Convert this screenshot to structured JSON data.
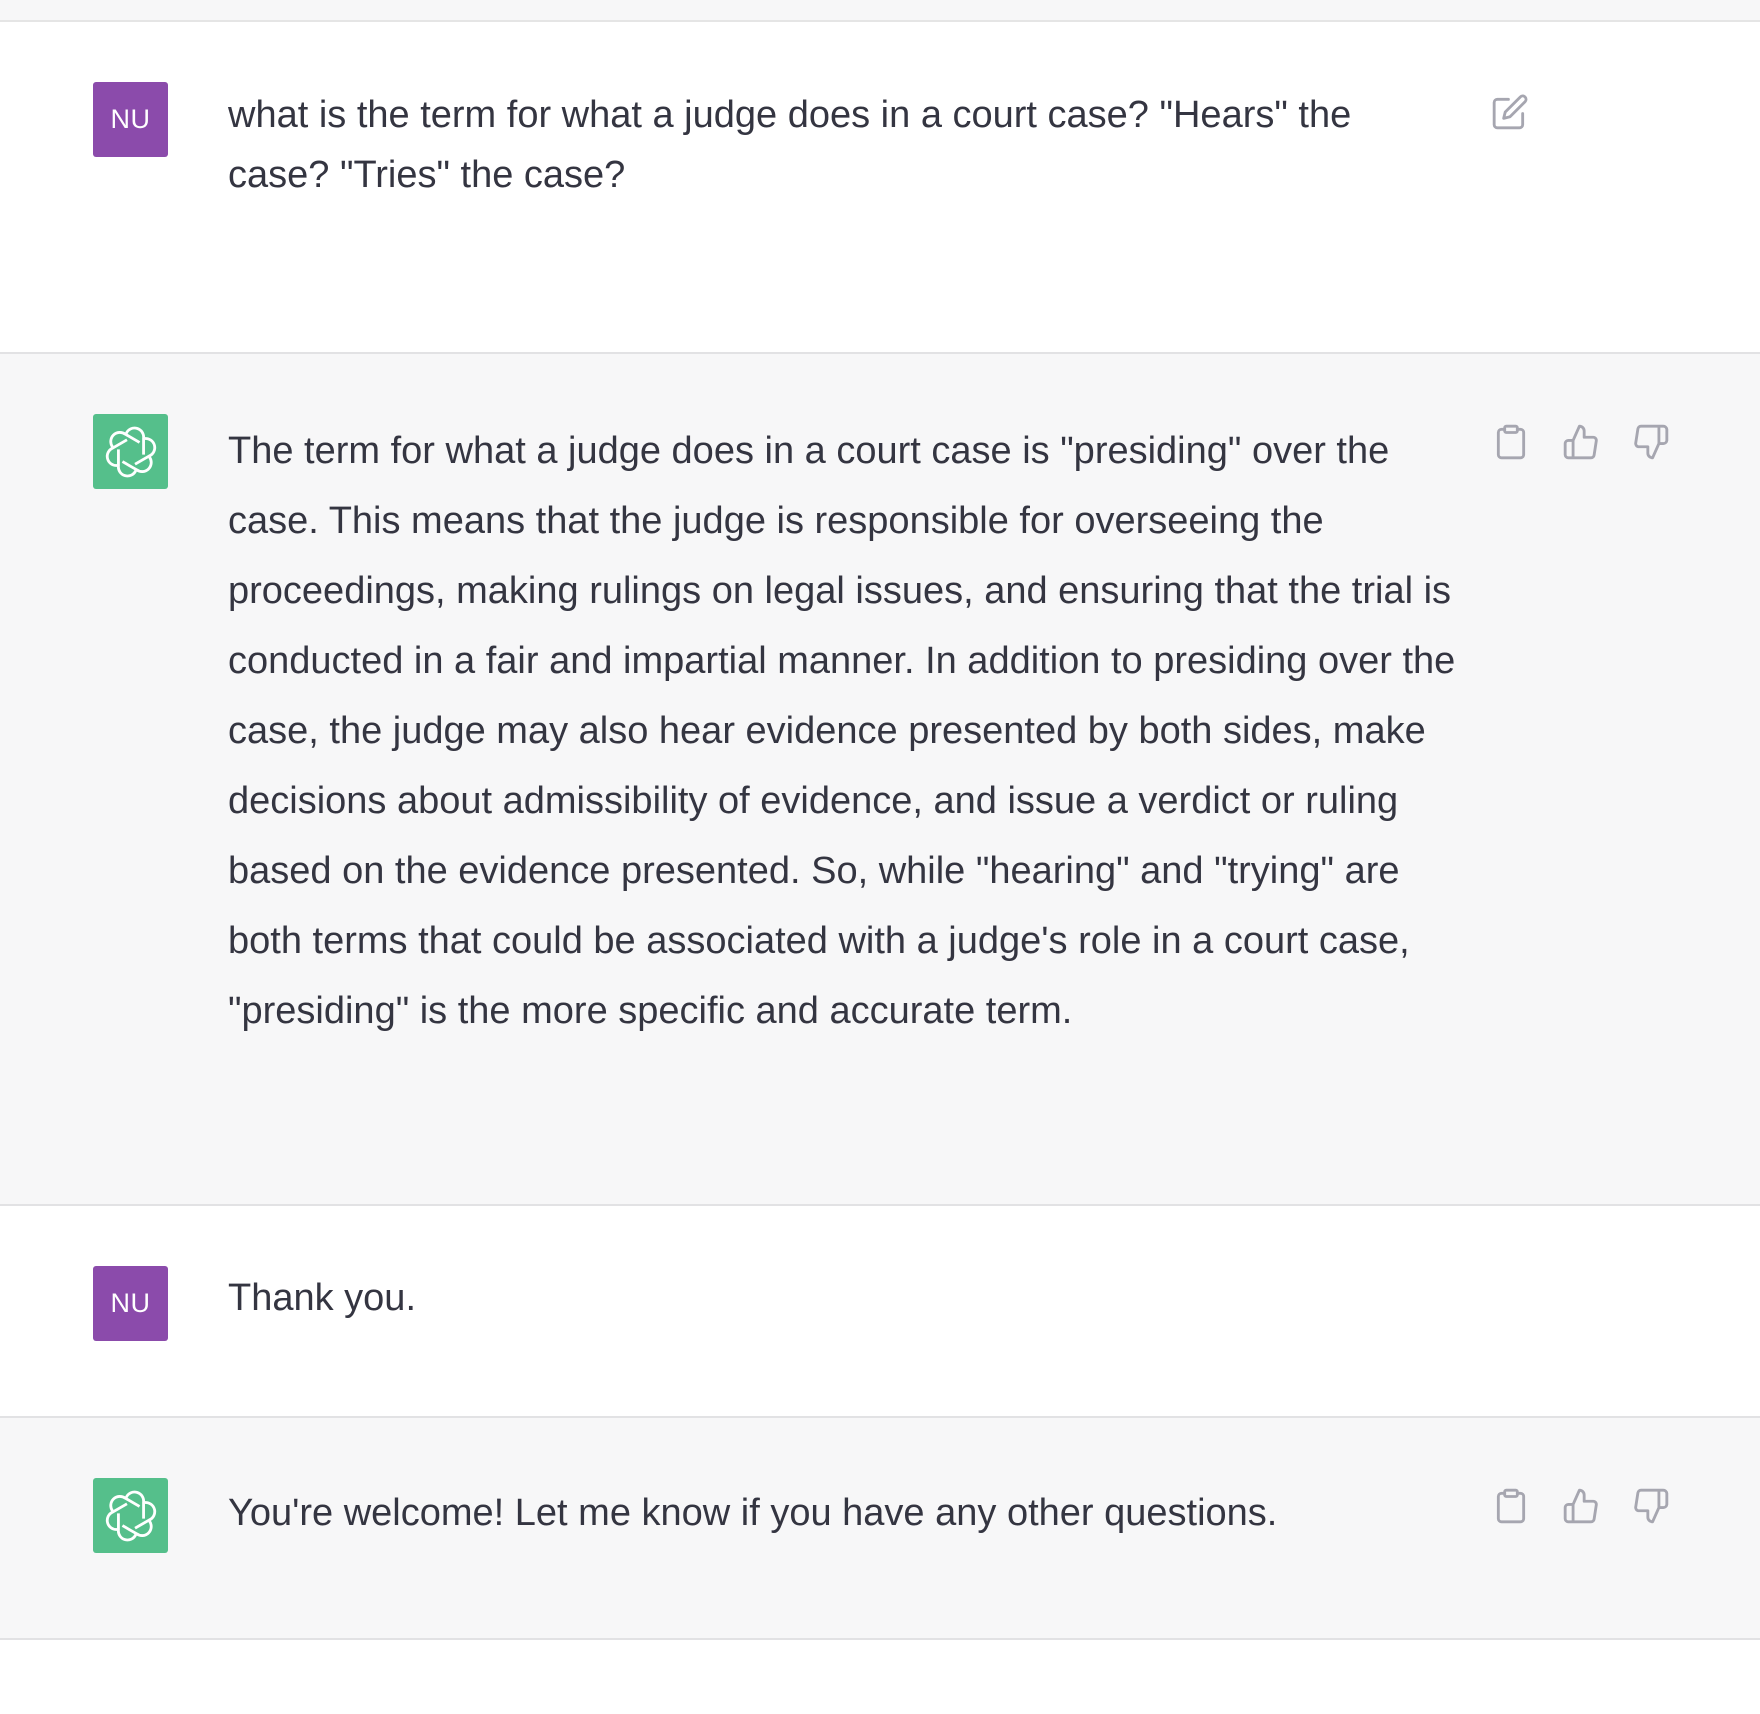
{
  "conversation": {
    "messages": [
      {
        "role": "user",
        "avatar_initials": "NU",
        "text": "what is the term for what a judge does in a court case? \"Hears\" the case? \"Tries\" the case?",
        "actions": [
          "edit-icon"
        ]
      },
      {
        "role": "assistant",
        "avatar_icon": "openai-logo-icon",
        "text": "The term for what a judge does in a court case is \"presiding\" over the case. This means that the judge is responsible for overseeing the proceedings, making rulings on legal issues, and ensuring that the trial is conducted in a fair and impartial manner. In addition to presiding over the case, the judge may also hear evidence presented by both sides, make decisions about admissibility of evidence, and issue a verdict or ruling based on the evidence presented. So, while \"hearing\" and \"trying\" are both terms that could be associated with a judge's role in a court case, \"presiding\" is the more specific and accurate term.",
        "actions": [
          "clipboard-icon",
          "thumbs-up-icon",
          "thumbs-down-icon"
        ]
      },
      {
        "role": "user",
        "avatar_initials": "NU",
        "text": "Thank you.",
        "actions": []
      },
      {
        "role": "assistant",
        "avatar_icon": "openai-logo-icon",
        "text": "You're welcome! Let me know if you have any other questions.",
        "actions": [
          "clipboard-icon",
          "thumbs-up-icon",
          "thumbs-down-icon"
        ]
      }
    ]
  },
  "colors": {
    "user_avatar": "#8b4bab",
    "assistant_avatar": "#55bf8b",
    "assistant_row_bg": "#f7f7f8",
    "text": "#343541",
    "icon": "#a6a6b0"
  }
}
